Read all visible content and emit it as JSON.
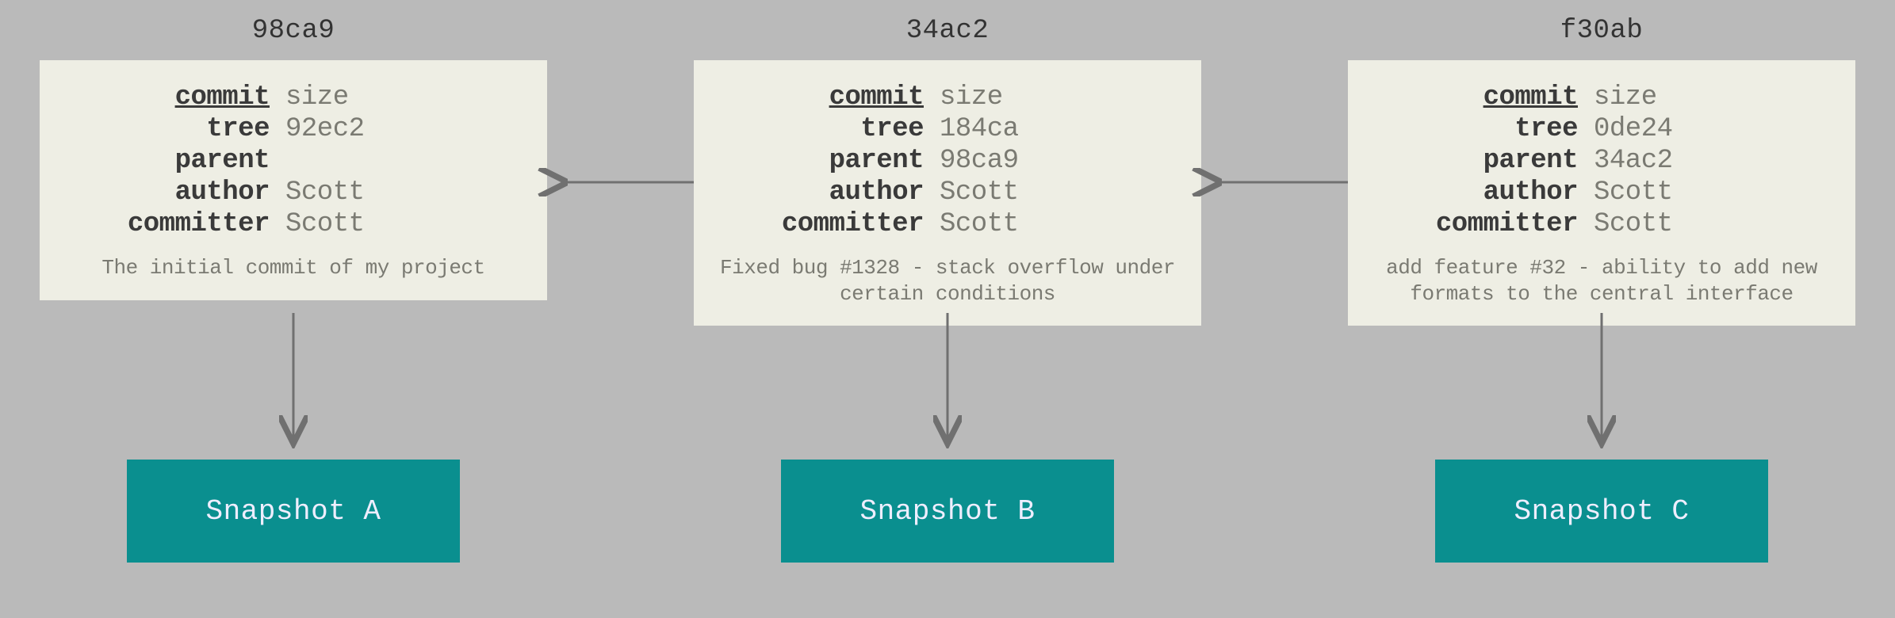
{
  "commits": [
    {
      "hash": "98ca9",
      "fields": {
        "commit": "size",
        "tree": "92ec2",
        "parent": "",
        "author": "Scott",
        "committer": "Scott"
      },
      "message": "The initial commit of my project",
      "snapshot": "Snapshot A"
    },
    {
      "hash": "34ac2",
      "fields": {
        "commit": "size",
        "tree": "184ca",
        "parent": "98ca9",
        "author": "Scott",
        "committer": "Scott"
      },
      "message": "Fixed bug #1328 - stack overflow under certain conditions",
      "snapshot": "Snapshot B"
    },
    {
      "hash": "f30ab",
      "fields": {
        "commit": "size",
        "tree": "0de24",
        "parent": "34ac2",
        "author": "Scott",
        "committer": "Scott"
      },
      "message": "add feature #32 - ability to add new formats to the central interface",
      "snapshot": "Snapshot C"
    }
  ],
  "field_labels": {
    "commit": "commit",
    "tree": "tree",
    "parent": "parent",
    "author": "author",
    "committer": "committer"
  },
  "colors": {
    "background": "#bababa",
    "commit_box": "#eeeee4",
    "snapshot_bg": "#0a8f8f",
    "snapshot_fg": "#eeffff",
    "arrow": "#707070"
  }
}
